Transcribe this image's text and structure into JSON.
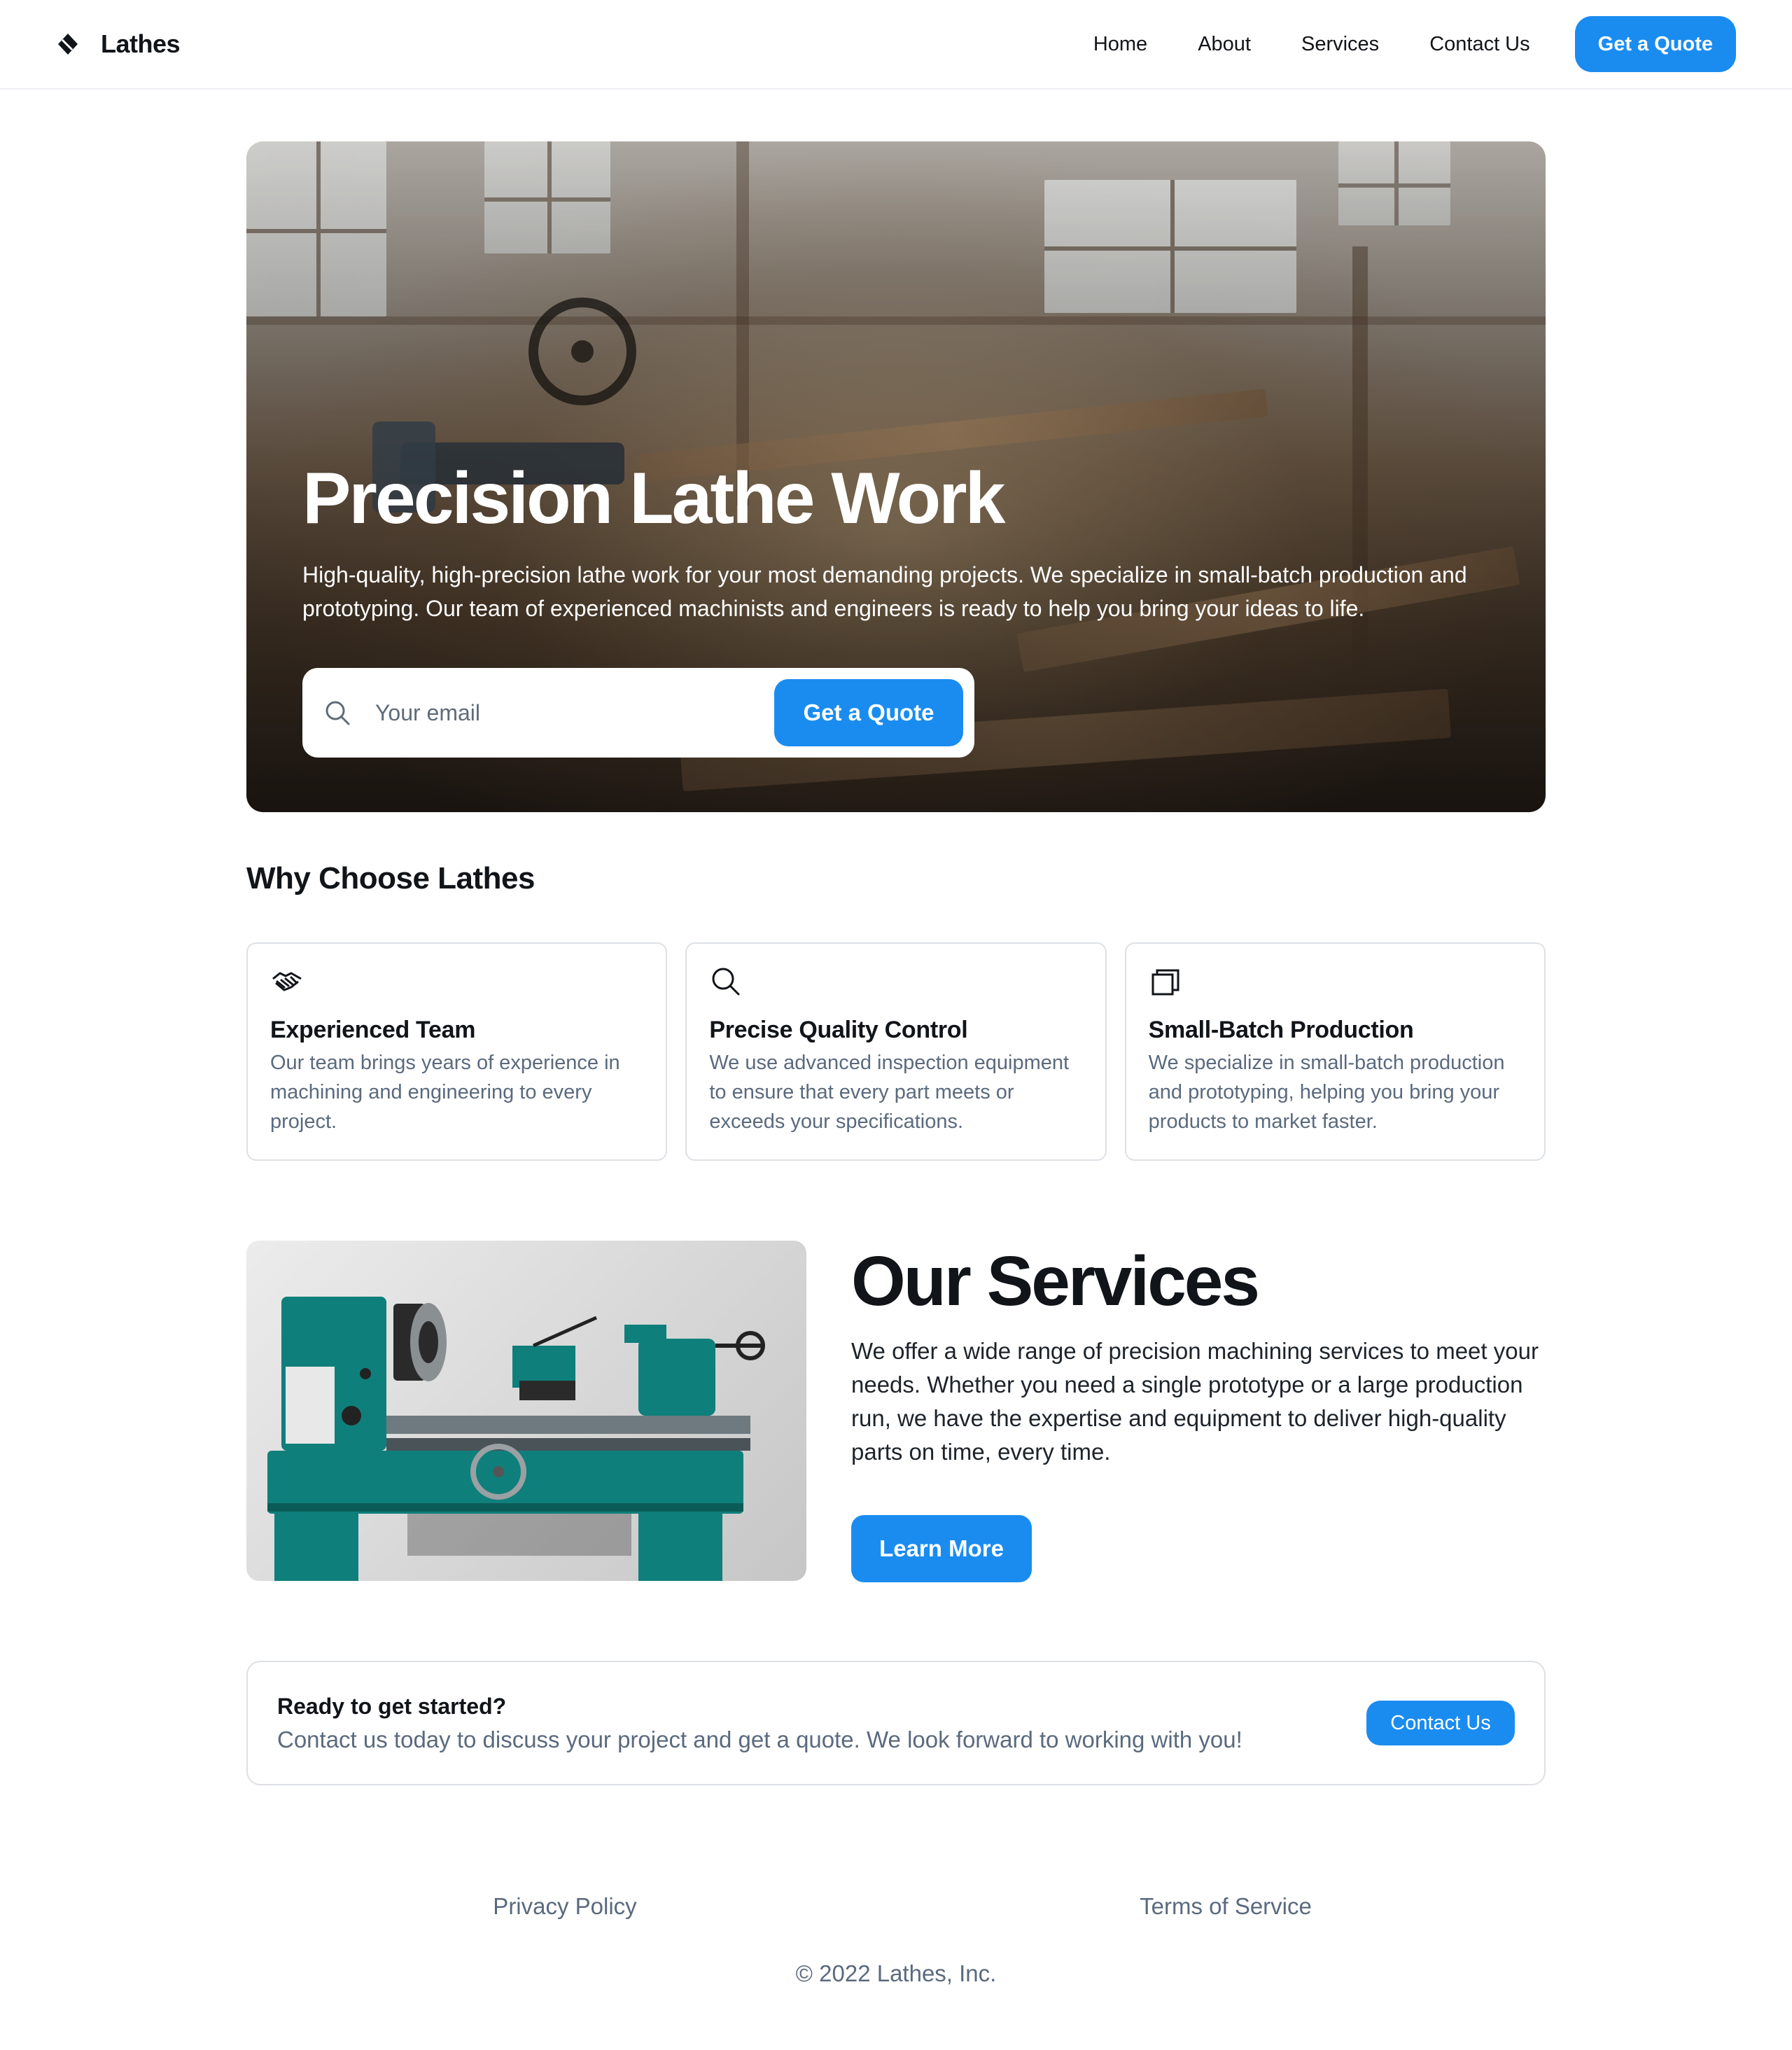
{
  "header": {
    "brand": "Lathes",
    "nav": [
      "Home",
      "About",
      "Services",
      "Contact Us"
    ],
    "cta_label": "Get a Quote"
  },
  "hero": {
    "title": "Precision Lathe Work",
    "subtitle": "High-quality, high-precision lathe work for your most demanding projects. We specialize in small-batch production and prototyping. Our team of experienced machinists and engineers is ready to help you bring your ideas to life.",
    "email_placeholder": "Your email",
    "button_label": "Get a Quote"
  },
  "why": {
    "title": "Why Choose Lathes",
    "features": [
      {
        "icon": "handshake-icon",
        "title": "Experienced Team",
        "text": "Our team brings years of experience in machining and engineering to every project."
      },
      {
        "icon": "search-icon",
        "title": "Precise Quality Control",
        "text": "We use advanced inspection equipment to ensure that every part meets or exceeds your specifications."
      },
      {
        "icon": "copy-icon",
        "title": "Small-Batch Production",
        "text": "We specialize in small-batch production and prototyping, helping you bring your products to market faster."
      }
    ]
  },
  "services": {
    "title": "Our Services",
    "text": "We offer a wide range of precision machining services to meet your needs. Whether you need a single prototype or a large production run, we have the expertise and equipment to deliver high-quality parts on time, every time.",
    "button_label": "Learn More"
  },
  "cta": {
    "title": "Ready to get started?",
    "text": "Contact us today to discuss your project and get a quote. We look forward to working with you!",
    "button_label": "Contact Us"
  },
  "footer": {
    "links": [
      "Privacy Policy",
      "Terms of Service"
    ],
    "copyright": "© 2022 Lathes, Inc."
  },
  "colors": {
    "accent": "#1a8cf0",
    "muted_text": "#5a6a7e",
    "border": "#dde1e6",
    "machine_teal": "#0f7f7b"
  }
}
